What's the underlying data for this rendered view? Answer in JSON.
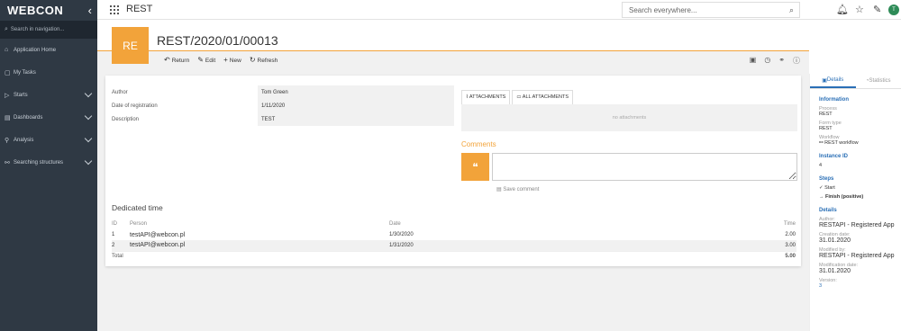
{
  "brand": {
    "logo": "WEBCON",
    "accent": "#f2a33a",
    "sidebar_bg": "#2f3944",
    "link": "#2a6fb6"
  },
  "nav": {
    "search_placeholder": "Search in navigation...",
    "items": [
      {
        "label": "Application Home",
        "icon": "home-icon"
      },
      {
        "label": "My Tasks",
        "icon": "tasks-icon"
      },
      {
        "label": "Starts",
        "icon": "play-icon",
        "expandable": true
      },
      {
        "label": "Dashboards",
        "icon": "dashboard-icon",
        "expandable": true
      },
      {
        "label": "Analysis",
        "icon": "analysis-icon",
        "expandable": true
      },
      {
        "label": "Searching structures",
        "icon": "search-structure-icon",
        "expandable": true
      }
    ]
  },
  "topbar": {
    "app_title": "REST",
    "search_placeholder": "Search everywhere...",
    "avatar_initial": "T"
  },
  "form": {
    "badge": "RE",
    "title": "REST/2020/01/00013",
    "toolbar": {
      "return": "Return",
      "edit": "Edit",
      "new": "New",
      "refresh": "Refresh"
    },
    "fields": [
      {
        "label": "Author",
        "value": "Tom Green"
      },
      {
        "label": "Date of registration",
        "value": "1/11/2020"
      },
      {
        "label": "Description",
        "value": "TEST"
      }
    ],
    "attachments": {
      "tab1": "ATTACHMENTS",
      "tab2": "ALL ATTACHMENTS",
      "empty": "no attachments"
    },
    "comments": {
      "title": "Comments",
      "save": "Save comment"
    },
    "dedicated": {
      "title": "Dedicated time",
      "headers": [
        "ID",
        "Person",
        "Date",
        "Time"
      ],
      "rows": [
        {
          "id": "1",
          "person": "testAPI@webcon.pl",
          "date": "1/30/2020",
          "time": "2.00"
        },
        {
          "id": "2",
          "person": "testAPI@webcon.pl",
          "date": "1/31/2020",
          "time": "3.00"
        }
      ],
      "total_label": "Total",
      "total_value": "5.00"
    }
  },
  "panel": {
    "tab_details": "Details",
    "tab_statistics": "Statistics",
    "information": "Information",
    "process_label": "Process",
    "process_value": "REST",
    "form_type_label": "Form type",
    "form_type_value": "REST",
    "workflow_label": "Workflow",
    "workflow_value": "REST workflow",
    "instance_label": "Instance ID",
    "instance_value": "4",
    "steps_label": "Steps",
    "step1": "Start",
    "step2": "Finish (positive)",
    "details_label": "Details",
    "author_label": "Author:",
    "author_value": "RESTAPI - Registered App",
    "creation_label": "Creation date:",
    "creation_value": "31.01.2020",
    "modified_label": "Modified by:",
    "modified_value": "RESTAPI - Registered App",
    "modification_label": "Modification date:",
    "modification_value": "31.01.2020",
    "version_label": "Version:",
    "version_value": "3"
  }
}
